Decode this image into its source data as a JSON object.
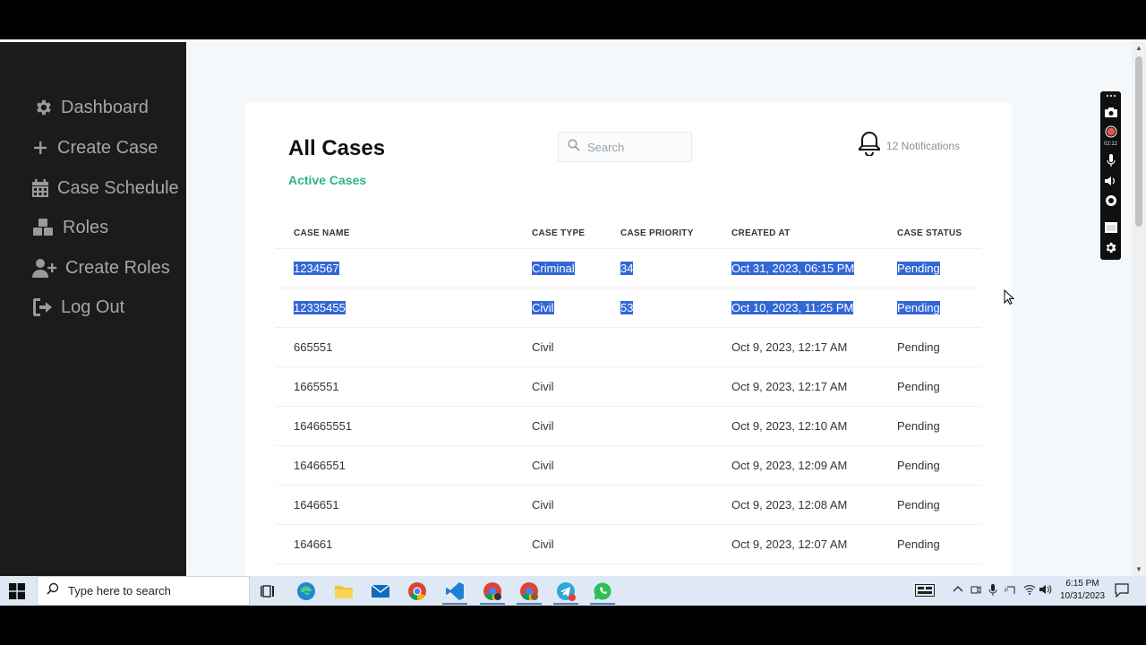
{
  "sidebar": {
    "items": [
      {
        "label": "Dashboard",
        "icon": "gear-icon"
      },
      {
        "label": "Create Case",
        "icon": "plus-icon"
      },
      {
        "label": "Case Schedule",
        "icon": "calendar-icon"
      },
      {
        "label": "Roles",
        "icon": "boxes-icon"
      },
      {
        "label": "Create Roles",
        "icon": "user-plus-icon"
      },
      {
        "label": "Log Out",
        "icon": "logout-icon"
      }
    ]
  },
  "header": {
    "title": "All Cases",
    "subtitle": "Active Cases",
    "search_placeholder": "Search",
    "notifications_label": "12 Notifications"
  },
  "table": {
    "columns": [
      "CASE NAME",
      "CASE TYPE",
      "CASE PRIORITY",
      "CREATED AT",
      "CASE STATUS"
    ],
    "rows": [
      {
        "name": "1234567",
        "type": "Criminal",
        "priority": "34",
        "created": "Oct 31, 2023, 06:15 PM",
        "status": "Pending"
      },
      {
        "name": "12335455",
        "type": "Civil",
        "priority": "53",
        "created": "Oct 10, 2023, 11:25 PM",
        "status": "Pending"
      },
      {
        "name": "665551",
        "type": "Civil",
        "priority": "",
        "created": "Oct 9, 2023, 12:17 AM",
        "status": "Pending"
      },
      {
        "name": "1665551",
        "type": "Civil",
        "priority": "",
        "created": "Oct 9, 2023, 12:17 AM",
        "status": "Pending"
      },
      {
        "name": "164665551",
        "type": "Civil",
        "priority": "",
        "created": "Oct 9, 2023, 12:10 AM",
        "status": "Pending"
      },
      {
        "name": "16466551",
        "type": "Civil",
        "priority": "",
        "created": "Oct 9, 2023, 12:09 AM",
        "status": "Pending"
      },
      {
        "name": "1646651",
        "type": "Civil",
        "priority": "",
        "created": "Oct 9, 2023, 12:08 AM",
        "status": "Pending"
      },
      {
        "name": "164661",
        "type": "Civil",
        "priority": "",
        "created": "Oct 9, 2023, 12:07 AM",
        "status": "Pending"
      }
    ]
  },
  "recorder": {
    "elapsed": "02:12"
  },
  "taskbar": {
    "search_placeholder": "Type here to search",
    "time": "6:15 PM",
    "date": "10/31/2023"
  },
  "colors": {
    "sidebar_bg": "#1b1b1b",
    "accent_green": "#2bb58a",
    "selection": "#3367d6"
  }
}
